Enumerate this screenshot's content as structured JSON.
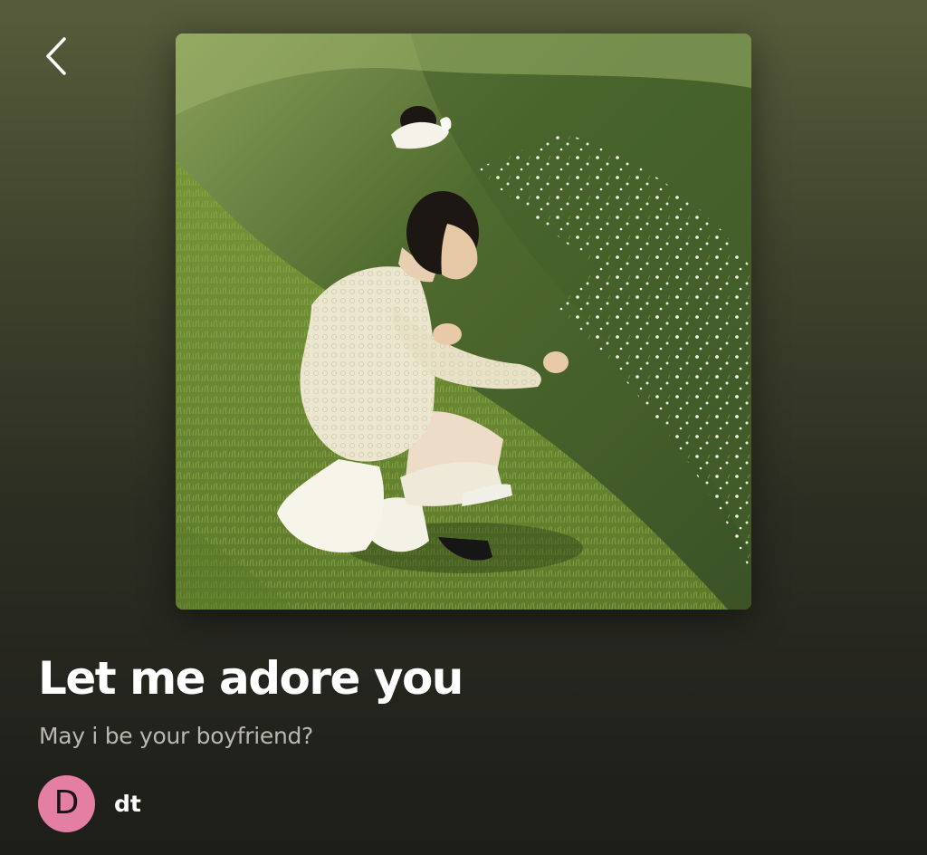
{
  "nav": {
    "back_icon": "chevron-left-icon"
  },
  "playlist": {
    "cover_image": "playlist-cover-photo",
    "title": "Let me adore you",
    "description": "May i be your boyfriend?",
    "owner": {
      "initial": "D",
      "name": "dt",
      "avatar_color": "#e47ea3"
    }
  },
  "colors": {
    "background_top": "#565c3b",
    "background_bottom": "#1d1d19",
    "title": "#ffffff",
    "description": "#b8b8ae"
  }
}
